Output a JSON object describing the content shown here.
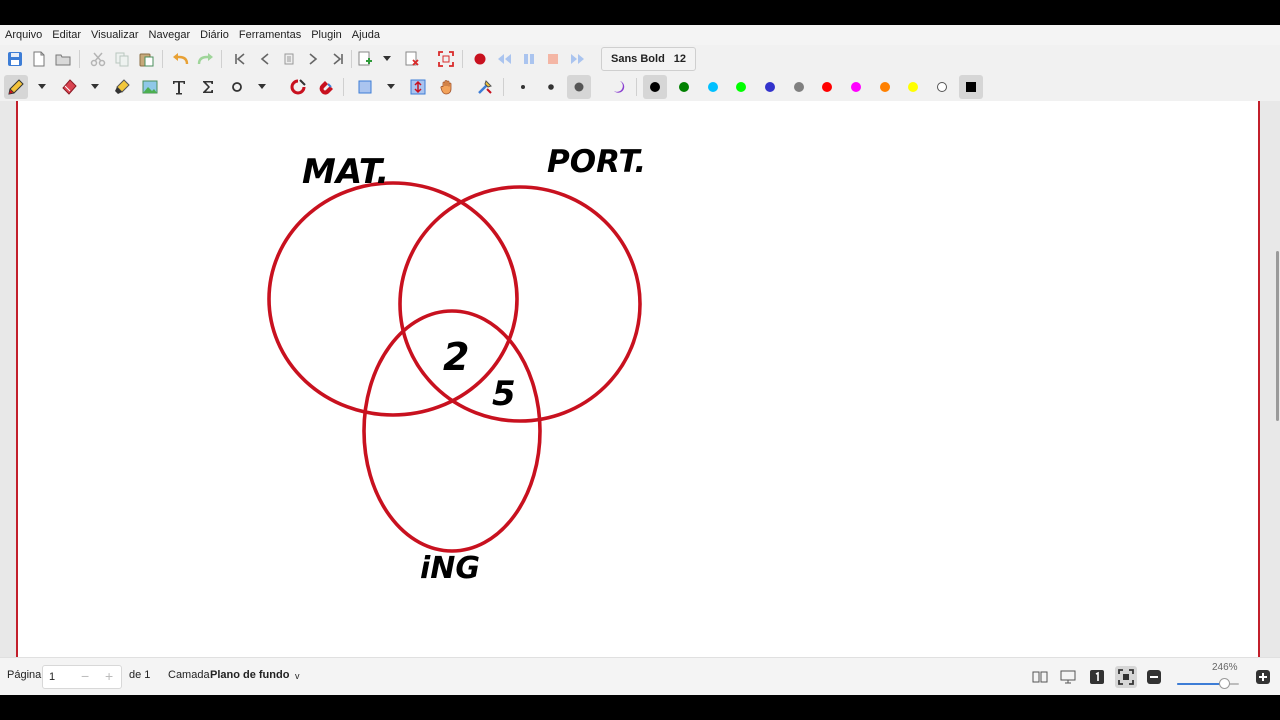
{
  "menu": [
    "Arquivo",
    "Editar",
    "Visualizar",
    "Navegar",
    "Diário",
    "Ferramentas",
    "Plugin",
    "Ajuda"
  ],
  "font": {
    "name": "Sans Bold",
    "size": "12"
  },
  "palette": [
    "#000000",
    "#008000",
    "#00c0ff",
    "#00ff00",
    "#3333cc",
    "#808080",
    "#ff0000",
    "#ff00ff",
    "#ff8000",
    "#ffff00",
    "#ffffff"
  ],
  "selected_color": "#000000",
  "accent_red": "#c8111f",
  "drawing": {
    "label_mat": "MAT.",
    "label_port": "PORT.",
    "label_ing": "iNG",
    "intersection_all": "2",
    "intersection_port_ing": "5"
  },
  "status": {
    "page_label": "Página",
    "page_value": "1",
    "page_of": "de 1",
    "layer_label": "Camada",
    "layer_value": "Plano de fundo",
    "zoom": "246%",
    "zoom_level": 0.75
  }
}
